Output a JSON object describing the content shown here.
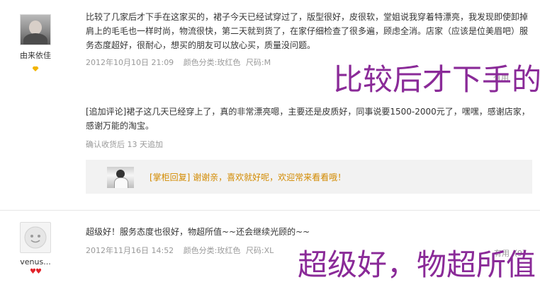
{
  "reviews": [
    {
      "username": "由来依佳",
      "text": "比较了几家后才下手在这家买的，裙子今天已经试穿过了，版型很好，皮很软，堂姐说我穿着特漂亮，我发现即使卸掉肩上的毛毛也一样时尚，物流很快，第二天就到货了，在家仔细检查了很多遍，顾虑全消。店家（应该是位美眉吧）服务态度超好，很耐心，想买的朋友可以放心买，质量没问题。",
      "date": "2012年10月10日 21:09",
      "color_label": "颜色分类:玫红色",
      "size_label": "尺码:M",
      "useful": "有用",
      "overlay_caption": "比较后才下手的",
      "append": {
        "text": "[追加评论]裙子这几天已经穿上了，真的非常漂亮嗯，主要还是皮质好，同事说要1500-2000元了，嘿嘿，感谢店家，感谢万能的淘宝。",
        "note": "确认收货后 13 天追加"
      },
      "reply": {
        "text": "[掌柜回复] 谢谢亲，喜欢就好呢，欢迎常来看看哦！"
      }
    },
    {
      "username": "venus...",
      "text": "超级好！服务态度也很好，物超所值~~还会继续光顾的~~",
      "date": "2012年11月16日 14:52",
      "color_label": "颜色分类:玫红色",
      "size_label": "尺码:XL",
      "useful": "有用（9）",
      "overlay_caption": "超级好，物超所值"
    }
  ],
  "colors": {
    "caption": "#8a2a98",
    "reply": "#d28a00",
    "meta": "#999999",
    "badge_gold": "#f2b400",
    "badge_red": "#e2232a"
  },
  "icons": {
    "badge1": "gold-diamond-icon",
    "badge2": "red-hearts-icon"
  }
}
